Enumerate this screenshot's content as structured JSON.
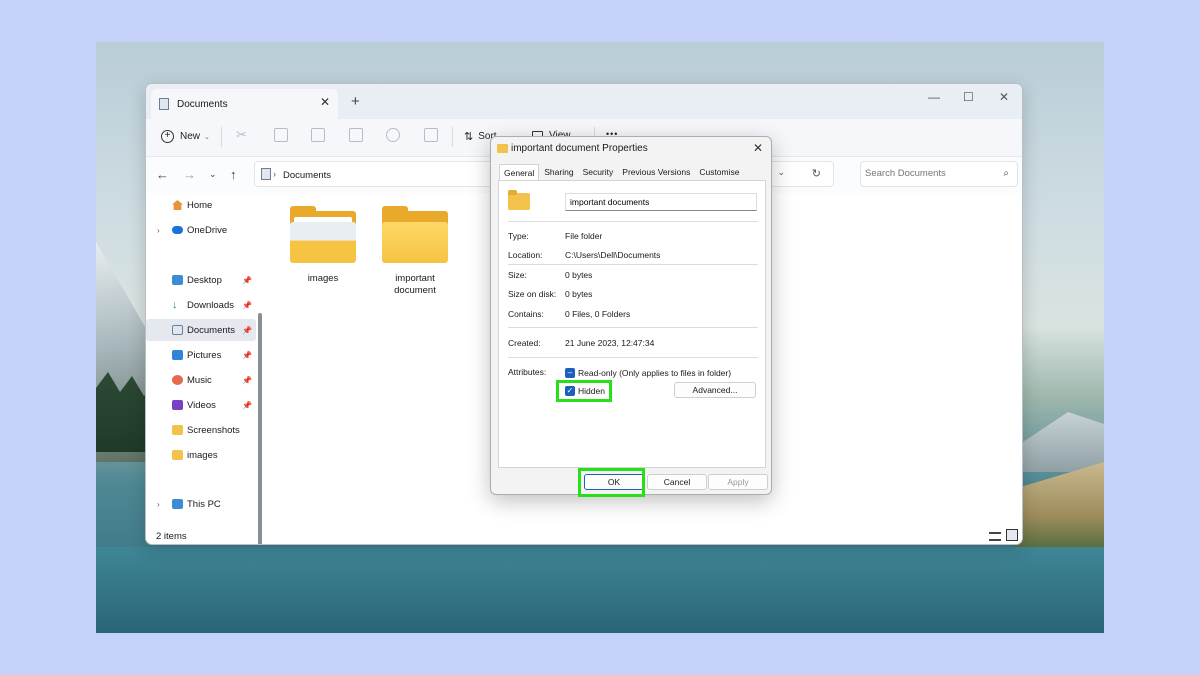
{
  "explorer": {
    "tab_title": "Documents",
    "tab_close": "✕",
    "new_tab": "+",
    "win_min": "—",
    "win_max": "☐",
    "win_close": "✕",
    "toolbar": {
      "new_label": "New",
      "sort_label": "Sort",
      "view_label": "View",
      "more_label": "•••"
    },
    "path_label": "Documents",
    "search_placeholder": "Search Documents",
    "sidebar": [
      {
        "label": "Home",
        "icon": "home-icon"
      },
      {
        "label": "OneDrive",
        "icon": "cloud-icon"
      },
      {
        "label": "Desktop",
        "icon": "desktop-icon"
      },
      {
        "label": "Downloads",
        "icon": "download-icon"
      },
      {
        "label": "Documents",
        "icon": "documents-icon"
      },
      {
        "label": "Pictures",
        "icon": "pictures-icon"
      },
      {
        "label": "Music",
        "icon": "music-icon"
      },
      {
        "label": "Videos",
        "icon": "videos-icon"
      },
      {
        "label": "Screenshots",
        "icon": "folder-icon"
      },
      {
        "label": "images",
        "icon": "folder-icon"
      },
      {
        "label": "This PC",
        "icon": "pc-icon"
      }
    ],
    "folders": [
      {
        "name": "images"
      },
      {
        "name": "important\ndocument"
      }
    ],
    "status": "2 items"
  },
  "dialog": {
    "title": "important document Properties",
    "close": "✕",
    "tabs": [
      "General",
      "Sharing",
      "Security",
      "Previous Versions",
      "Customise"
    ],
    "folder_name": "important documents",
    "props": {
      "type_label": "Type:",
      "type_value": "File folder",
      "location_label": "Location:",
      "location_value": "C:\\Users\\Dell\\Documents",
      "size_label": "Size:",
      "size_value": "0 bytes",
      "sizeondisk_label": "Size on disk:",
      "sizeondisk_value": "0 bytes",
      "contains_label": "Contains:",
      "contains_value": "0 Files, 0 Folders",
      "created_label": "Created:",
      "created_value": "21 June 2023, 12:47:34",
      "attributes_label": "Attributes:"
    },
    "readonly_label": "Read-only (Only applies to files in folder)",
    "hidden_label": "Hidden",
    "advanced_label": "Advanced...",
    "ok_label": "OK",
    "cancel_label": "Cancel",
    "apply_label": "Apply"
  },
  "colors": {
    "highlight": "#27e01a",
    "accent": "#1d5fbf",
    "background": "#c5d1f8"
  }
}
